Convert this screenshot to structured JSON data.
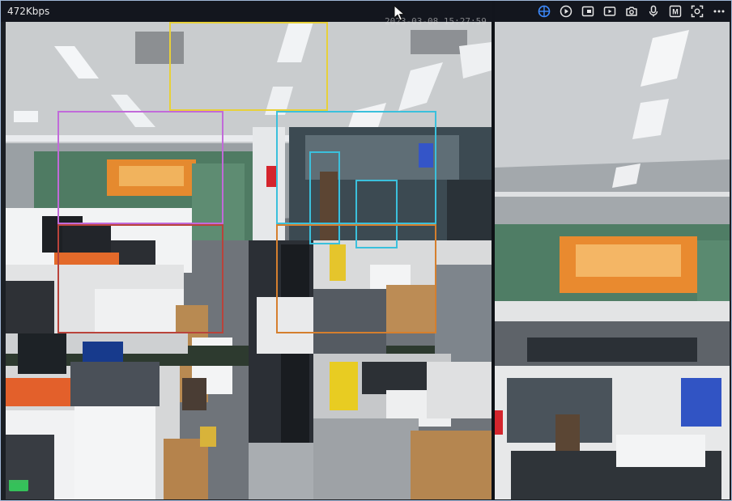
{
  "topbar": {
    "bitrate": "472Kbps",
    "timestamp": "2023-03-08 15:27:59"
  },
  "toolbar": {
    "buttons": [
      {
        "name": "ptz-icon",
        "color": "#3d8bff"
      },
      {
        "name": "play-icon",
        "color": "#e6e6e6"
      },
      {
        "name": "stream-switch-icon",
        "color": "#e6e6e6"
      },
      {
        "name": "record-icon",
        "color": "#e6e6e6"
      },
      {
        "name": "snapshot-icon",
        "color": "#e6e6e6"
      },
      {
        "name": "microphone-icon",
        "color": "#e6e6e6"
      },
      {
        "name": "m-box-icon",
        "color": "#e6e6e6",
        "label": "M"
      },
      {
        "name": "face-scan-icon",
        "color": "#e6e6e6"
      },
      {
        "name": "more-icon",
        "color": "#e6e6e6"
      }
    ]
  },
  "detections": {
    "colors": {
      "yellow": "#e7d03a",
      "purple": "#c16ad9",
      "red": "#b9433b",
      "cyan": "#3bc0dc",
      "orange": "#d57f2e"
    }
  }
}
